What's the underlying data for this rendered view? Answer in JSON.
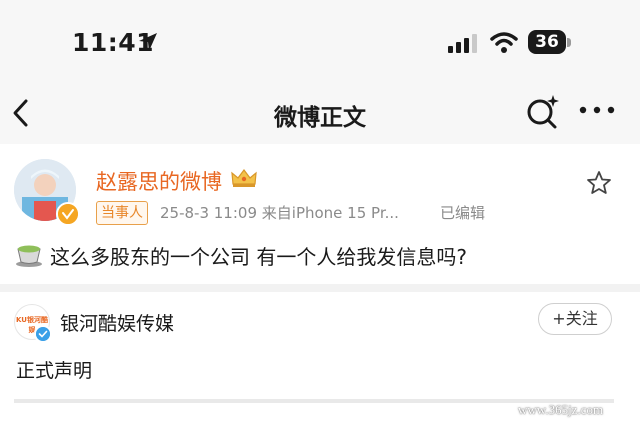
{
  "status_bar": {
    "time": "11:41",
    "battery": "36"
  },
  "nav": {
    "title": "微博正文"
  },
  "post": {
    "author": "赵露思的微博",
    "role_badge": "当事人",
    "timestamp": "25-8-3 11:09",
    "source": "来自iPhone 15 Pr...",
    "edited": "已编辑",
    "text": "这么多股东的一个公司 有一个人给我发信息吗?",
    "author_color": "#e86722"
  },
  "repost": {
    "avatar_text": "KU银河酷娱",
    "name": "银河酷娱传媒",
    "follow_label": "+关注",
    "text": "正式声明"
  },
  "watermark": "www.365jz.com",
  "icons": [
    "location-arrow-icon",
    "signal-icon",
    "wifi-icon",
    "back-icon",
    "search-sparkle-icon",
    "more-icon",
    "crown-icon",
    "star-icon",
    "tea-icon",
    "verified-icon"
  ]
}
